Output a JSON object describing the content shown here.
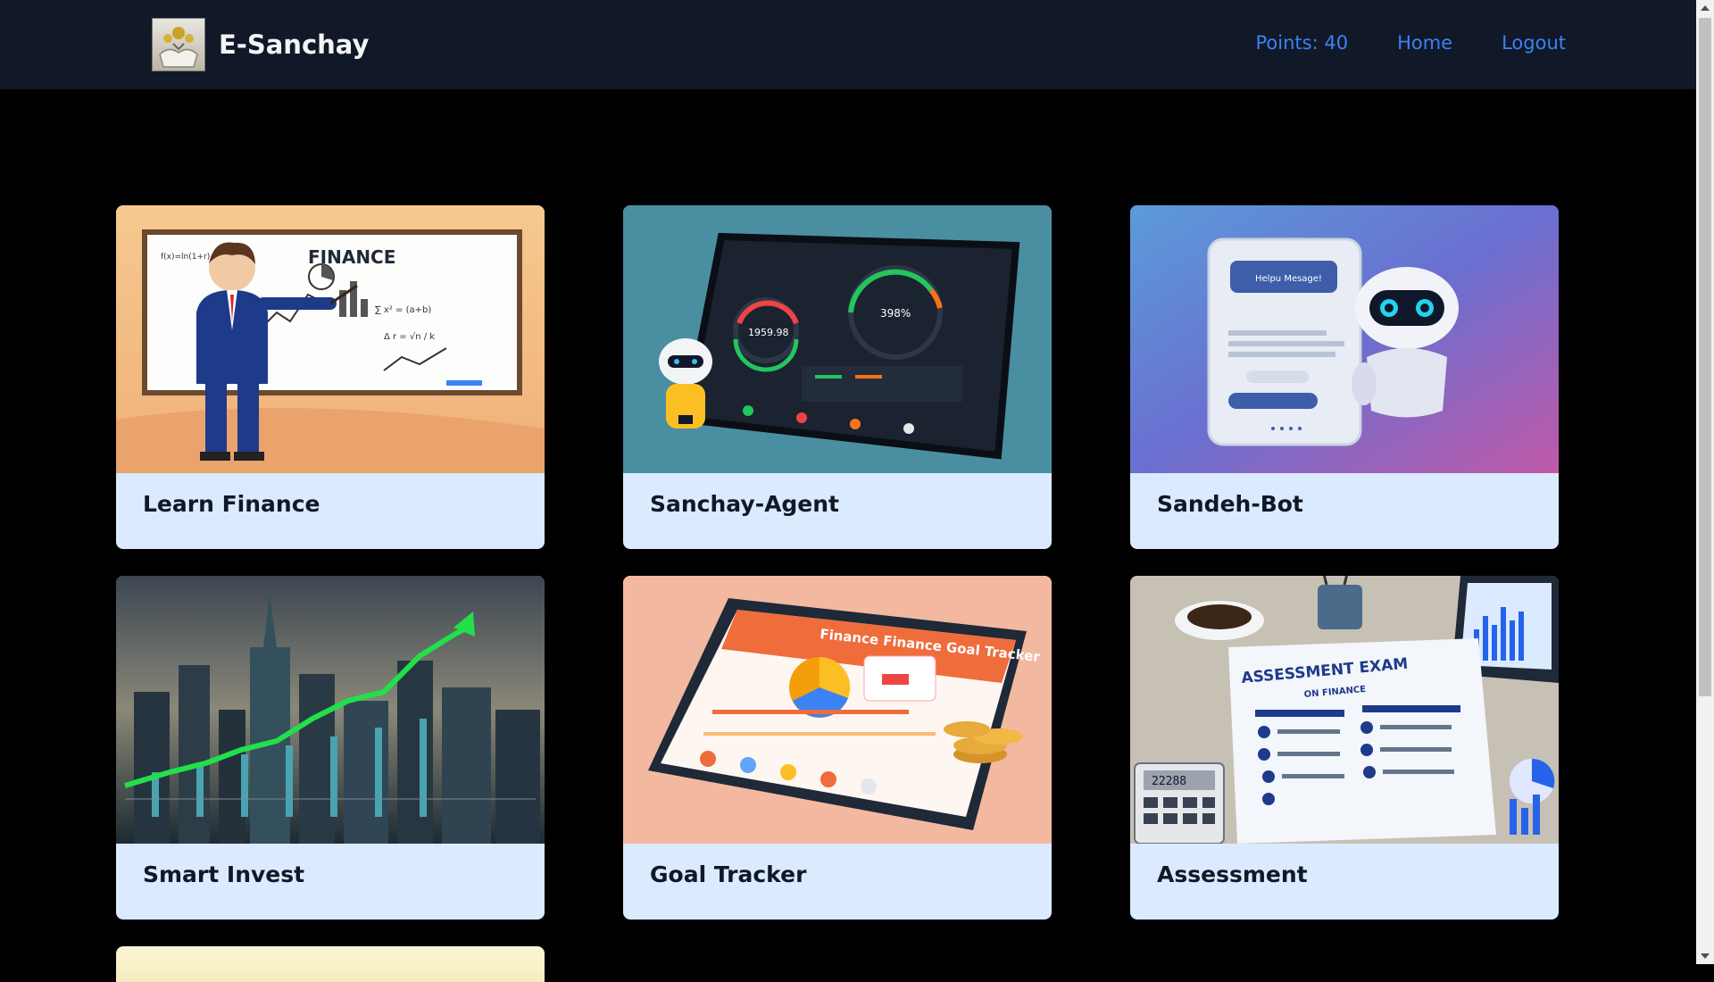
{
  "app": {
    "brand": "E-Sanchay"
  },
  "nav": {
    "points": "Points: 40",
    "home": "Home",
    "logout": "Logout"
  },
  "cards": [
    {
      "title": "Learn Finance",
      "image": "finance-teacher-whiteboard"
    },
    {
      "title": "Sanchay-Agent",
      "image": "tablet-dashboard-robot"
    },
    {
      "title": "Sandeh-Bot",
      "image": "chatbot-robot-phone"
    },
    {
      "title": "Smart Invest",
      "image": "city-stock-growth-chart"
    },
    {
      "title": "Goal Tracker",
      "image": "tablet-goal-tracker"
    },
    {
      "title": "Assessment",
      "image": "assessment-exam-desk"
    }
  ],
  "images_text": {
    "finance_board": "FINANCE",
    "dashboard_value": "1959.98",
    "dashboard_percent": "398%",
    "chat_bubble": "Helpu Mesage!",
    "goal_title": "Finance Finance Goal Tracker",
    "exam_title": "ASSESSMENT EXAM",
    "exam_sub": "ON FINANCE",
    "exam_calc": "22288"
  },
  "colors": {
    "nav_bg": "#111827",
    "accent": "#3b82f6",
    "card_bg": "#dbeafe"
  }
}
